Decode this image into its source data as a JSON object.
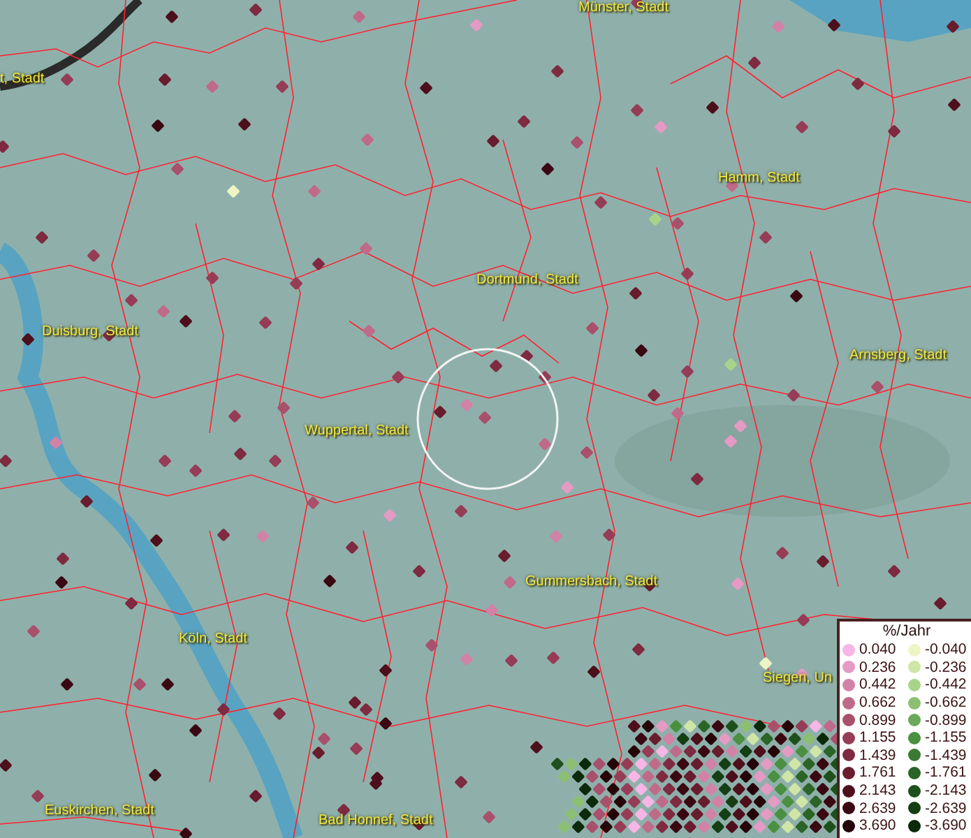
{
  "map": {
    "places": [
      {
        "name": "t, Stadt"
      },
      {
        "name": "Münster, Stadt"
      },
      {
        "name": "Hamm, Stadt"
      },
      {
        "name": "Dortmund, Stadt"
      },
      {
        "name": "Duisburg, Stadt"
      },
      {
        "name": "Arnsberg, Stadt"
      },
      {
        "name": "Wuppertal, Stadt"
      },
      {
        "name": "Gummersbach, Stadt"
      },
      {
        "name": "Köln, Stadt"
      },
      {
        "name": "Siegen, Un"
      },
      {
        "name": "Euskirchen, Stadt"
      },
      {
        "name": "Bad Honnef, Stadt"
      }
    ]
  },
  "legend": {
    "title": "%/Jahr",
    "rows": [
      {
        "positive": {
          "label": "0.040",
          "color": "#f7b6e6"
        },
        "negative": {
          "label": "-0.040",
          "color": "#eef5c4"
        }
      },
      {
        "positive": {
          "label": "0.236",
          "color": "#e59ac4"
        },
        "negative": {
          "label": "-0.236",
          "color": "#cfe6a6"
        }
      },
      {
        "positive": {
          "label": "0.442",
          "color": "#d282a6"
        },
        "negative": {
          "label": "-0.442",
          "color": "#a8d48a"
        }
      },
      {
        "positive": {
          "label": "0.662",
          "color": "#c06a8a"
        },
        "negative": {
          "label": "-0.662",
          "color": "#8cbf72"
        }
      },
      {
        "positive": {
          "label": "0.899",
          "color": "#a8506c"
        },
        "negative": {
          "label": "-0.899",
          "color": "#6aa85a"
        }
      },
      {
        "positive": {
          "label": "1.155",
          "color": "#963c56"
        },
        "negative": {
          "label": "-1.155",
          "color": "#4a9040"
        }
      },
      {
        "positive": {
          "label": "1.439",
          "color": "#7e2a40"
        },
        "negative": {
          "label": "-1.439",
          "color": "#3a7a32"
        }
      },
      {
        "positive": {
          "label": "1.761",
          "color": "#681c2e"
        },
        "negative": {
          "label": "-1.761",
          "color": "#2a6426"
        }
      },
      {
        "positive": {
          "label": "2.143",
          "color": "#4e0f1c"
        },
        "negative": {
          "label": "-2.143",
          "color": "#1e501c"
        }
      },
      {
        "positive": {
          "label": "2.639",
          "color": "#3a0812"
        },
        "negative": {
          "label": "-2.639",
          "color": "#143e14"
        }
      },
      {
        "positive": {
          "label": "3.690",
          "color": "#250308"
        },
        "negative": {
          "label": "-3.690",
          "color": "#0a2a0a"
        }
      }
    ]
  }
}
